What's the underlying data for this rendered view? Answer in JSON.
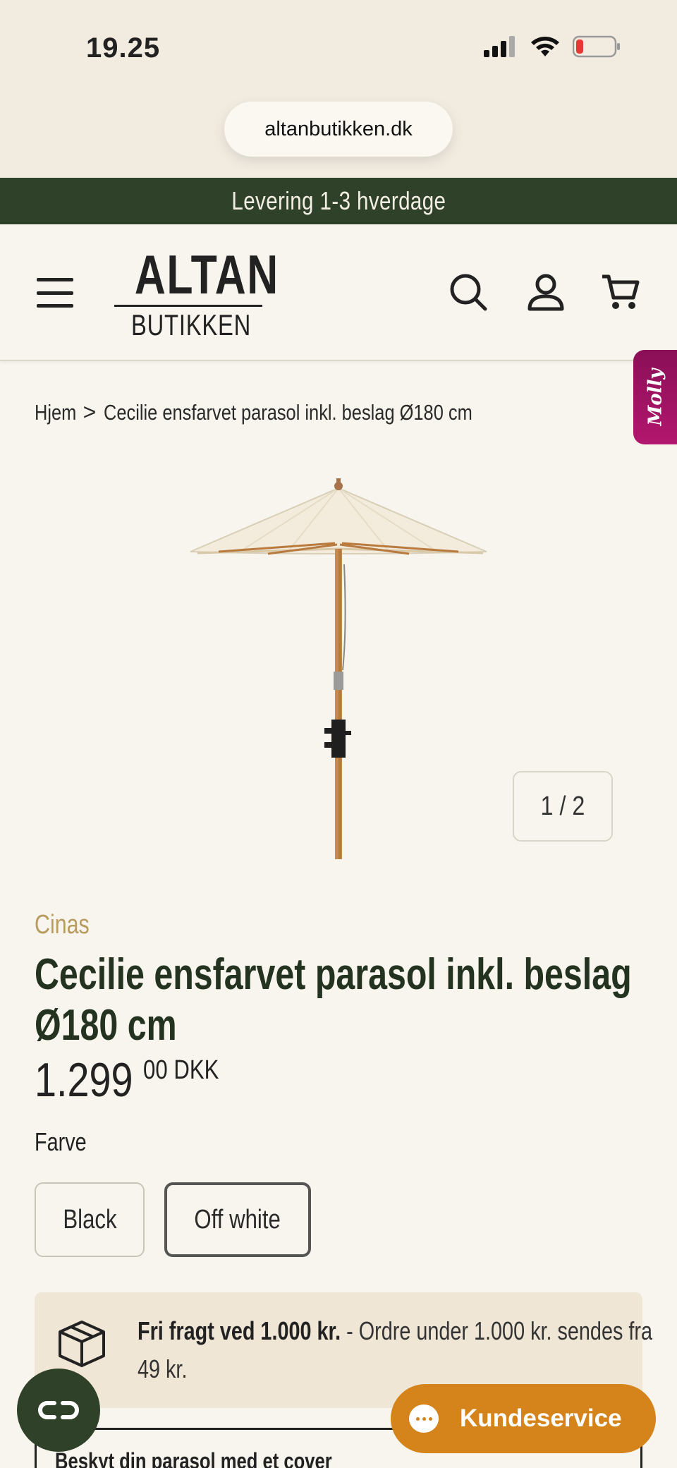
{
  "status_bar": {
    "time": "19.25",
    "battery_level": 0.15
  },
  "browser": {
    "url": "altanbutikken.dk"
  },
  "announcement": "Levering 1-3 hverdage",
  "header": {
    "logo_top": "ALTAN",
    "logo_bottom": "BUTIKKEN",
    "icons": [
      "menu-icon",
      "search-icon",
      "account-icon",
      "cart-icon"
    ]
  },
  "molly_tab": "Molly",
  "breadcrumb": {
    "home": "Hjem",
    "separator": ">",
    "current": "Cecilie ensfarvet parasol inkl. beslag Ø180 cm"
  },
  "gallery": {
    "counter": "1 / 2"
  },
  "product": {
    "brand": "Cinas",
    "title": "Cecilie ensfarvet parasol inkl. beslag Ø180 cm",
    "price_main": "1.299",
    "price_decimals": "00 DKK",
    "option_label": "Farve",
    "options": [
      {
        "label": "Black",
        "selected": false
      },
      {
        "label": "Off white",
        "selected": true
      }
    ]
  },
  "shipping": {
    "bold": "Fri fragt ved 1.000 kr.",
    "rest": " - Ordre under 1.000 kr. sendes fra 49 kr."
  },
  "cover_upsell": "Beskyt din parasol med et cover",
  "kundeservice_label": "Kundeservice",
  "colors": {
    "brand_green": "#2f4129",
    "accent_orange": "#d5841b",
    "brand_gold": "#b89c5f",
    "molly_magenta": "#a0135f"
  }
}
